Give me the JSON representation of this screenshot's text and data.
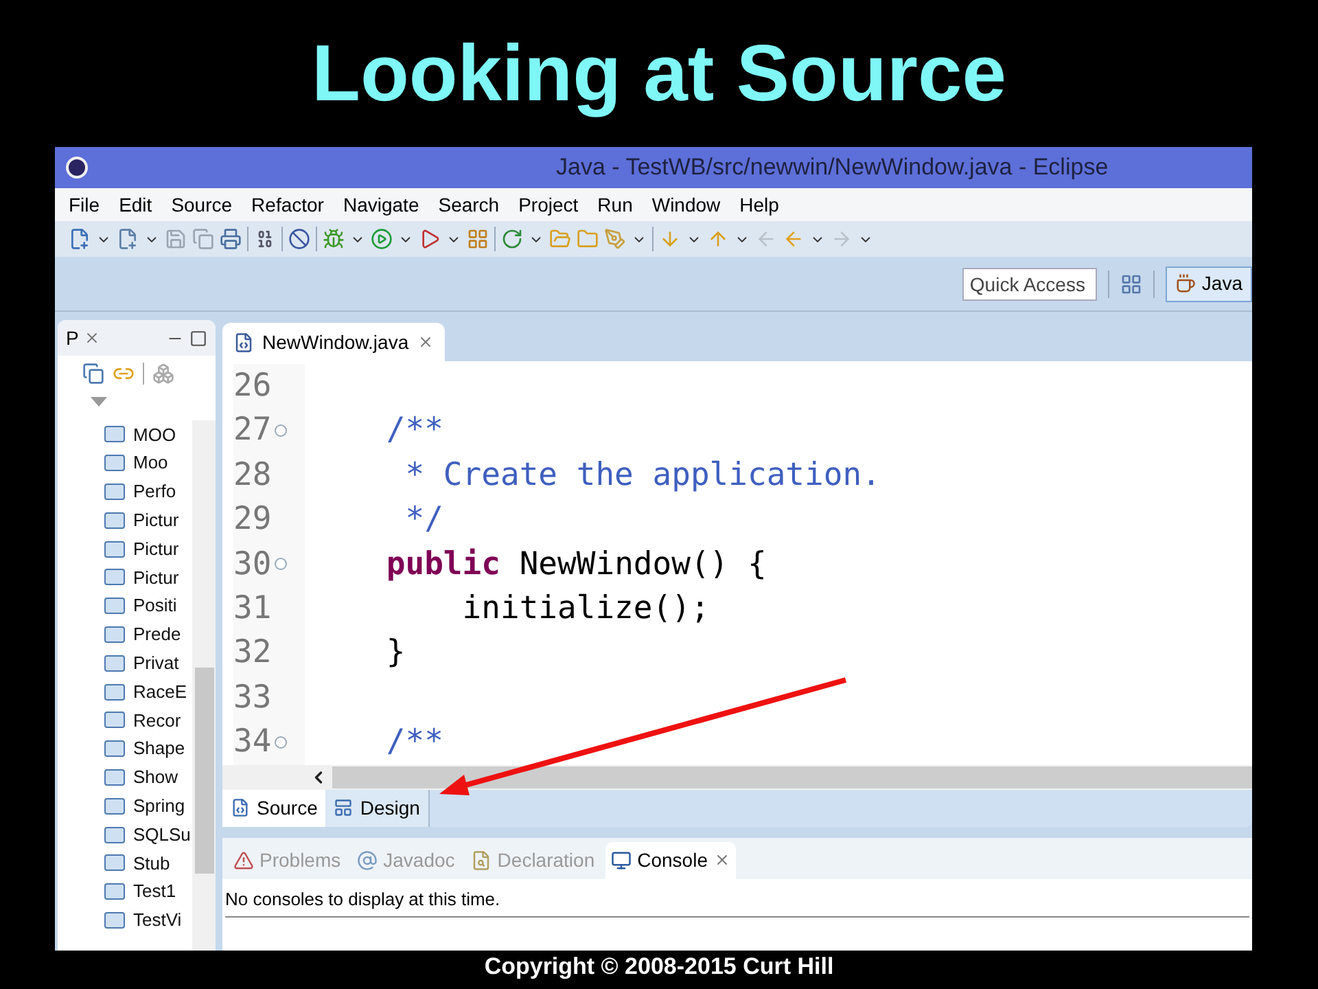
{
  "slide_title": "Looking at Source",
  "window": {
    "title": "Java - TestWB/src/newwin/NewWindow.java - Eclipse",
    "menu": [
      "File",
      "Edit",
      "Source",
      "Refactor",
      "Navigate",
      "Search",
      "Project",
      "Run",
      "Window",
      "Help"
    ],
    "quick_access": {
      "placeholder": "Quick Access"
    },
    "perspective": {
      "label": "Java",
      "selected": true
    }
  },
  "explorer": {
    "tab_label": "P",
    "items": [
      "MOO",
      "Moo",
      "Perfo",
      "Pictur",
      "Pictur",
      "Pictur",
      "Positi",
      "Prede",
      "Privat",
      "RaceE",
      "Recor",
      "Shape",
      "Show",
      "Spring",
      "SQLSu",
      "Stub",
      "Test1",
      "TestVi"
    ]
  },
  "editor": {
    "tab_label": "NewWindow.java",
    "lines": [
      {
        "number": "26",
        "fold": false
      },
      {
        "number": "27",
        "fold": true,
        "tokens": [
          {
            "text": "    /**",
            "kind": "comment"
          }
        ]
      },
      {
        "number": "28",
        "fold": false,
        "tokens": [
          {
            "text": "     * Create the application.",
            "kind": "comment"
          }
        ]
      },
      {
        "number": "29",
        "fold": false,
        "tokens": [
          {
            "text": "     */",
            "kind": "comment"
          }
        ]
      },
      {
        "number": "30",
        "fold": true,
        "tokens": [
          {
            "text": "    public",
            "kind": "keyword"
          },
          {
            "text": " NewWindow() {",
            "kind": "plain"
          }
        ]
      },
      {
        "number": "31",
        "fold": false,
        "tokens": [
          {
            "text": "        initialize();",
            "kind": "plain"
          }
        ]
      },
      {
        "number": "32",
        "fold": false,
        "tokens": [
          {
            "text": "    }",
            "kind": "plain"
          }
        ]
      },
      {
        "number": "33",
        "fold": false
      },
      {
        "number": "34",
        "fold": true,
        "tokens": [
          {
            "text": "    /**",
            "kind": "comment"
          }
        ]
      }
    ],
    "bottom_tabs": [
      {
        "label": "Source",
        "selected": true
      },
      {
        "label": "Design",
        "selected": false
      }
    ]
  },
  "console": {
    "tabs": [
      {
        "label": "Problems",
        "selected": false
      },
      {
        "label": "Javadoc",
        "selected": false
      },
      {
        "label": "Declaration",
        "selected": false
      },
      {
        "label": "Console",
        "selected": true
      }
    ],
    "message": "No consoles to display at this time."
  },
  "footer": "Copyright © 2008-2015 Curt Hill"
}
